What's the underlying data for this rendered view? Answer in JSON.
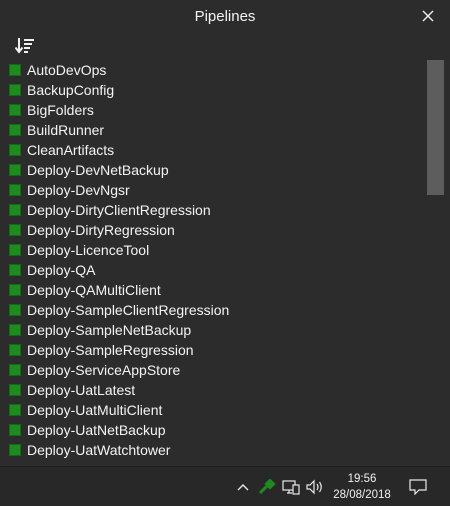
{
  "window": {
    "title": "Pipelines"
  },
  "toolbar": {
    "sort_icon": "sort-descending-icon"
  },
  "pipelines": [
    {
      "label": "AutoDevOps",
      "status": "success"
    },
    {
      "label": "BackupConfig",
      "status": "success"
    },
    {
      "label": "BigFolders",
      "status": "success"
    },
    {
      "label": "BuildRunner",
      "status": "success"
    },
    {
      "label": "CleanArtifacts",
      "status": "success"
    },
    {
      "label": "Deploy-DevNetBackup",
      "status": "success"
    },
    {
      "label": "Deploy-DevNgsr",
      "status": "success"
    },
    {
      "label": "Deploy-DirtyClientRegression",
      "status": "success"
    },
    {
      "label": "Deploy-DirtyRegression",
      "status": "success"
    },
    {
      "label": "Deploy-LicenceTool",
      "status": "success"
    },
    {
      "label": "Deploy-QA",
      "status": "success"
    },
    {
      "label": "Deploy-QAMultiClient",
      "status": "success"
    },
    {
      "label": "Deploy-SampleClientRegression",
      "status": "success"
    },
    {
      "label": "Deploy-SampleNetBackup",
      "status": "success"
    },
    {
      "label": "Deploy-SampleRegression",
      "status": "success"
    },
    {
      "label": "Deploy-ServiceAppStore",
      "status": "success"
    },
    {
      "label": "Deploy-UatLatest",
      "status": "success"
    },
    {
      "label": "Deploy-UatMultiClient",
      "status": "success"
    },
    {
      "label": "Deploy-UatNetBackup",
      "status": "success"
    },
    {
      "label": "Deploy-UatWatchtower",
      "status": "success"
    }
  ],
  "colors": {
    "status_success": "#1f8a1f",
    "background": "#2c2c2c"
  },
  "taskbar": {
    "time": "19:56",
    "date": "28/08/2018",
    "tray_icons": [
      "chevron-up-icon",
      "gitlab-pipeline-icon",
      "network-icon",
      "volume-icon",
      "notifications-icon"
    ]
  }
}
